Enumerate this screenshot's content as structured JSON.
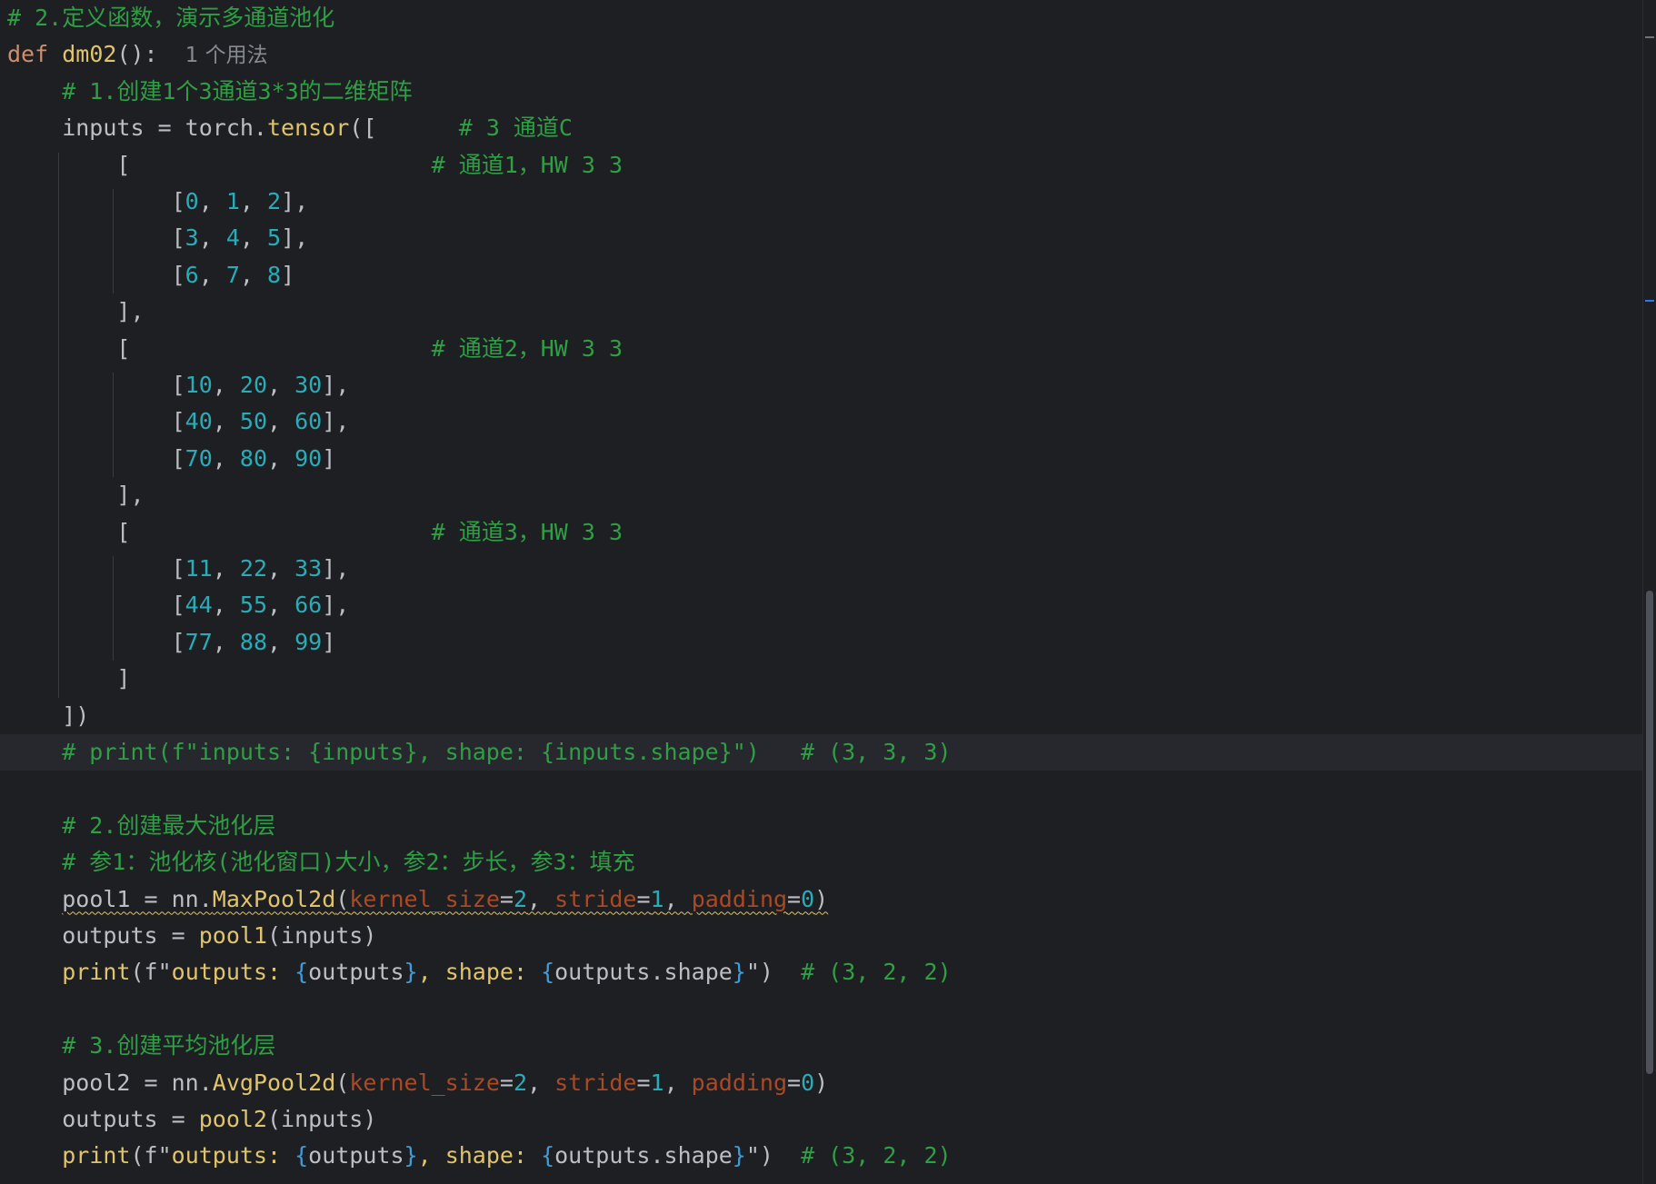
{
  "editor": {
    "language": "python",
    "current_line_index": 20,
    "lines": [
      [
        {
          "t": "# 2.定义函数，演示多通道池化",
          "c": "cm"
        }
      ],
      [
        {
          "t": "def ",
          "c": "kw"
        },
        {
          "t": "dm02",
          "c": "def"
        },
        {
          "t": "():  ",
          "c": "var"
        },
        {
          "t": "1 个用法",
          "c": "hint"
        }
      ],
      [
        {
          "t": "    # 1.创建1个3通道3*3的二维矩阵",
          "c": "cm"
        }
      ],
      [
        {
          "t": "    inputs = torch.",
          "c": "var"
        },
        {
          "t": "tensor",
          "c": "def"
        },
        {
          "t": "([      ",
          "c": "var"
        },
        {
          "t": "# 3 通道C",
          "c": "cm"
        }
      ],
      [
        {
          "t": "        [                      ",
          "c": "var"
        },
        {
          "t": "# 通道1，HW 3 3",
          "c": "cm"
        }
      ],
      [
        {
          "t": "            [",
          "c": "var"
        },
        {
          "t": "0",
          "c": "num"
        },
        {
          "t": ", ",
          "c": "var"
        },
        {
          "t": "1",
          "c": "num"
        },
        {
          "t": ", ",
          "c": "var"
        },
        {
          "t": "2",
          "c": "num"
        },
        {
          "t": "],",
          "c": "var"
        }
      ],
      [
        {
          "t": "            [",
          "c": "var"
        },
        {
          "t": "3",
          "c": "num"
        },
        {
          "t": ", ",
          "c": "var"
        },
        {
          "t": "4",
          "c": "num"
        },
        {
          "t": ", ",
          "c": "var"
        },
        {
          "t": "5",
          "c": "num"
        },
        {
          "t": "],",
          "c": "var"
        }
      ],
      [
        {
          "t": "            [",
          "c": "var"
        },
        {
          "t": "6",
          "c": "num"
        },
        {
          "t": ", ",
          "c": "var"
        },
        {
          "t": "7",
          "c": "num"
        },
        {
          "t": ", ",
          "c": "var"
        },
        {
          "t": "8",
          "c": "num"
        },
        {
          "t": "]",
          "c": "var"
        }
      ],
      [
        {
          "t": "        ],",
          "c": "var"
        }
      ],
      [
        {
          "t": "        [                      ",
          "c": "var"
        },
        {
          "t": "# 通道2，HW 3 3",
          "c": "cm"
        }
      ],
      [
        {
          "t": "            [",
          "c": "var"
        },
        {
          "t": "10",
          "c": "num"
        },
        {
          "t": ", ",
          "c": "var"
        },
        {
          "t": "20",
          "c": "num"
        },
        {
          "t": ", ",
          "c": "var"
        },
        {
          "t": "30",
          "c": "num"
        },
        {
          "t": "],",
          "c": "var"
        }
      ],
      [
        {
          "t": "            [",
          "c": "var"
        },
        {
          "t": "40",
          "c": "num"
        },
        {
          "t": ", ",
          "c": "var"
        },
        {
          "t": "50",
          "c": "num"
        },
        {
          "t": ", ",
          "c": "var"
        },
        {
          "t": "60",
          "c": "num"
        },
        {
          "t": "],",
          "c": "var"
        }
      ],
      [
        {
          "t": "            [",
          "c": "var"
        },
        {
          "t": "70",
          "c": "num"
        },
        {
          "t": ", ",
          "c": "var"
        },
        {
          "t": "80",
          "c": "num"
        },
        {
          "t": ", ",
          "c": "var"
        },
        {
          "t": "90",
          "c": "num"
        },
        {
          "t": "]",
          "c": "var"
        }
      ],
      [
        {
          "t": "        ],",
          "c": "var"
        }
      ],
      [
        {
          "t": "        [                      ",
          "c": "var"
        },
        {
          "t": "# 通道3，HW 3 3",
          "c": "cm"
        }
      ],
      [
        {
          "t": "            [",
          "c": "var"
        },
        {
          "t": "11",
          "c": "num"
        },
        {
          "t": ", ",
          "c": "var"
        },
        {
          "t": "22",
          "c": "num"
        },
        {
          "t": ", ",
          "c": "var"
        },
        {
          "t": "33",
          "c": "num"
        },
        {
          "t": "],",
          "c": "var"
        }
      ],
      [
        {
          "t": "            [",
          "c": "var"
        },
        {
          "t": "44",
          "c": "num"
        },
        {
          "t": ", ",
          "c": "var"
        },
        {
          "t": "55",
          "c": "num"
        },
        {
          "t": ", ",
          "c": "var"
        },
        {
          "t": "66",
          "c": "num"
        },
        {
          "t": "],",
          "c": "var"
        }
      ],
      [
        {
          "t": "            [",
          "c": "var"
        },
        {
          "t": "77",
          "c": "num"
        },
        {
          "t": ", ",
          "c": "var"
        },
        {
          "t": "88",
          "c": "num"
        },
        {
          "t": ", ",
          "c": "var"
        },
        {
          "t": "99",
          "c": "num"
        },
        {
          "t": "]",
          "c": "var"
        }
      ],
      [
        {
          "t": "        ]",
          "c": "var"
        }
      ],
      [
        {
          "t": "    ])",
          "c": "var"
        }
      ],
      [
        {
          "t": "    # print(f\"inputs: {inputs}, shape: {inputs.shape}\")   # (3, 3, 3)",
          "c": "cm"
        }
      ],
      [],
      [
        {
          "t": "    # 2.创建最大池化层",
          "c": "cm"
        }
      ],
      [
        {
          "t": "    # 参1：池化核(池化窗口)大小，参2：步长，参3：填充",
          "c": "cm"
        }
      ],
      [
        {
          "t": "    ",
          "c": "var"
        },
        {
          "t": "pool1 = nn.",
          "c": "var squiggle"
        },
        {
          "t": "MaxPool2d",
          "c": "def squiggle"
        },
        {
          "t": "(",
          "c": "var squiggle"
        },
        {
          "t": "kernel_size",
          "c": "par squiggle"
        },
        {
          "t": "=",
          "c": "var squiggle"
        },
        {
          "t": "2",
          "c": "num squiggle"
        },
        {
          "t": ", ",
          "c": "var squiggle"
        },
        {
          "t": "stride",
          "c": "par squiggle"
        },
        {
          "t": "=",
          "c": "var squiggle"
        },
        {
          "t": "1",
          "c": "num squiggle"
        },
        {
          "t": ", ",
          "c": "var squiggle"
        },
        {
          "t": "padding",
          "c": "par squiggle"
        },
        {
          "t": "=",
          "c": "var squiggle"
        },
        {
          "t": "0",
          "c": "num squiggle"
        },
        {
          "t": ")",
          "c": "var squiggle"
        }
      ],
      [
        {
          "t": "    outputs = ",
          "c": "var"
        },
        {
          "t": "pool1",
          "c": "def"
        },
        {
          "t": "(inputs)",
          "c": "var"
        }
      ],
      [
        {
          "t": "    ",
          "c": "var"
        },
        {
          "t": "print",
          "c": "builtin"
        },
        {
          "t": "(f\"",
          "c": "var"
        },
        {
          "t": "outputs: ",
          "c": "def"
        },
        {
          "t": "{",
          "c": "brace"
        },
        {
          "t": "outputs",
          "c": "var"
        },
        {
          "t": "}",
          "c": "brace"
        },
        {
          "t": ", shape: ",
          "c": "def"
        },
        {
          "t": "{",
          "c": "brace"
        },
        {
          "t": "outputs.shape",
          "c": "var"
        },
        {
          "t": "}",
          "c": "brace"
        },
        {
          "t": "\")  ",
          "c": "var"
        },
        {
          "t": "# (3, 2, 2)",
          "c": "cm"
        }
      ],
      [],
      [
        {
          "t": "    # 3.创建平均池化层",
          "c": "cm"
        }
      ],
      [
        {
          "t": "    pool2 = nn.",
          "c": "var"
        },
        {
          "t": "AvgPool2d",
          "c": "def"
        },
        {
          "t": "(",
          "c": "var"
        },
        {
          "t": "kernel_size",
          "c": "par"
        },
        {
          "t": "=",
          "c": "var"
        },
        {
          "t": "2",
          "c": "num"
        },
        {
          "t": ", ",
          "c": "var"
        },
        {
          "t": "stride",
          "c": "par"
        },
        {
          "t": "=",
          "c": "var"
        },
        {
          "t": "1",
          "c": "num"
        },
        {
          "t": ", ",
          "c": "var"
        },
        {
          "t": "padding",
          "c": "par"
        },
        {
          "t": "=",
          "c": "var"
        },
        {
          "t": "0",
          "c": "num"
        },
        {
          "t": ")",
          "c": "var"
        }
      ],
      [
        {
          "t": "    outputs = ",
          "c": "var"
        },
        {
          "t": "pool2",
          "c": "def"
        },
        {
          "t": "(inputs)",
          "c": "var"
        }
      ],
      [
        {
          "t": "    ",
          "c": "var"
        },
        {
          "t": "print",
          "c": "builtin"
        },
        {
          "t": "(f\"",
          "c": "var"
        },
        {
          "t": "outputs: ",
          "c": "def"
        },
        {
          "t": "{",
          "c": "brace"
        },
        {
          "t": "outputs",
          "c": "var"
        },
        {
          "t": "}",
          "c": "brace"
        },
        {
          "t": ", shape: ",
          "c": "def"
        },
        {
          "t": "{",
          "c": "brace"
        },
        {
          "t": "outputs.shape",
          "c": "var"
        },
        {
          "t": "}",
          "c": "brace"
        },
        {
          "t": "\")  ",
          "c": "var"
        },
        {
          "t": "# (3, 2, 2)",
          "c": "cm"
        }
      ]
    ]
  },
  "colors": {
    "background": "#1e1f22",
    "current_line": "#26282e",
    "comment": "#2f9e44",
    "number": "#2aacb8",
    "function": "#e0c46c",
    "parameter": "#aa4926",
    "keyword": "#cf8e6d"
  }
}
